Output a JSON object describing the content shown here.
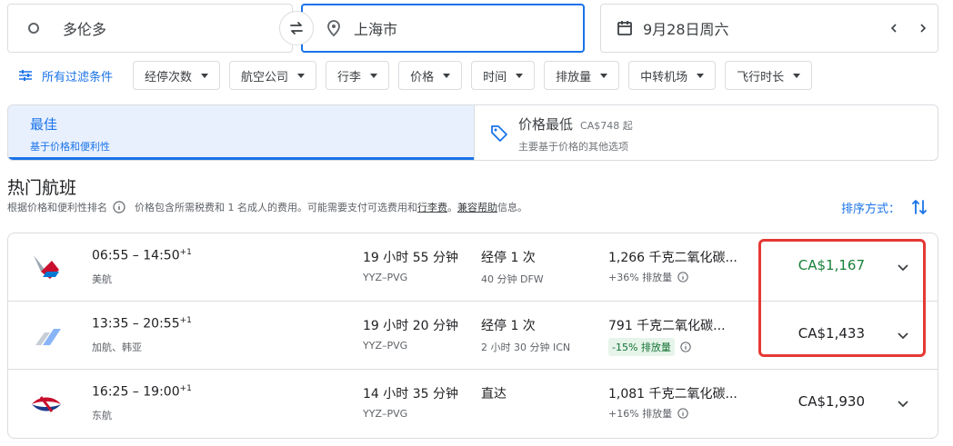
{
  "search": {
    "origin": "多伦多",
    "destination": "上海市",
    "date": "9月28日周六"
  },
  "filters": {
    "all_filters": "所有过滤条件",
    "chips": [
      "经停次数",
      "航空公司",
      "行李",
      "价格",
      "时间",
      "排放量",
      "中转机场",
      "飞行时长"
    ]
  },
  "tabs": {
    "best": {
      "title": "最佳",
      "subtitle": "基于价格和便利性"
    },
    "cheapest": {
      "title": "价格最低",
      "from": "CA$748 起",
      "subtitle": "主要基于价格的其他选项"
    }
  },
  "section": {
    "title": "热门航班",
    "sub_rank": "根据价格和便利性排名",
    "sub_note": "价格包含所需税费和 1 名成人的费用。可能需要支付可选费用和",
    "fees_link": "行李费",
    "sub_mid": "。",
    "help_link": "兼容帮助",
    "sub_end": "信息。",
    "sort_label": "排序方式："
  },
  "flights": [
    {
      "depart": "06:55",
      "arrive": "14:50",
      "plus_day": "+1",
      "airline": "美航",
      "duration": "19 小时 55 分钟",
      "route": "YYZ–PVG",
      "stops": "经停 1 次",
      "layover": "40 分钟 DFW",
      "co2": "1,266 千克二氧化碳...",
      "co2_diff": "+36% 排放量",
      "price": "CA$1,167"
    },
    {
      "depart": "13:35",
      "arrive": "20:55",
      "plus_day": "+1",
      "airline": "加航、韩亚",
      "duration": "19 小时 20 分钟",
      "route": "YYZ–PVG",
      "stops": "经停 1 次",
      "layover": "2 小时 30 分钟 ICN",
      "co2": "791 千克二氧化碳...",
      "co2_diff": "-15% 排放量",
      "price": "CA$1,433"
    },
    {
      "depart": "16:25",
      "arrive": "19:00",
      "plus_day": "+1",
      "airline": "东航",
      "duration": "14 小时 35 分钟",
      "route": "YYZ–PVG",
      "stops": "直达",
      "layover": "",
      "co2": "1,081 千克二氧化碳...",
      "co2_diff": "+16% 排放量",
      "price": "CA$1,930"
    }
  ],
  "colors": {
    "accent": "#1a73e8",
    "price_green": "#188038",
    "highlight": "#e53935"
  }
}
